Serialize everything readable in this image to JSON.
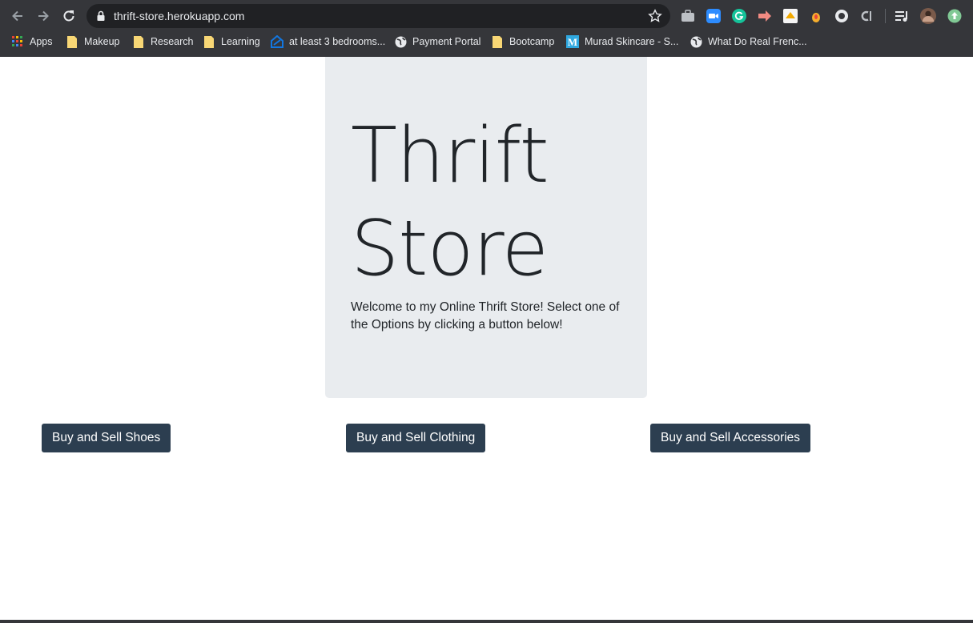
{
  "browser": {
    "url": "thrift-store.herokuapp.com",
    "bookmarks": [
      {
        "label": "Apps",
        "icon": "apps-grid-icon"
      },
      {
        "label": "Makeup",
        "icon": "folder-icon"
      },
      {
        "label": "Research",
        "icon": "folder-icon"
      },
      {
        "label": "Learning",
        "icon": "folder-icon"
      },
      {
        "label": "at least 3 bedrooms...",
        "icon": "zillow-icon"
      },
      {
        "label": "Payment Portal",
        "icon": "globe-icon"
      },
      {
        "label": "Bootcamp",
        "icon": "folder-icon"
      },
      {
        "label": "Murad Skincare - S...",
        "icon": "murad-icon"
      },
      {
        "label": "What Do Real Frenc...",
        "icon": "globe-icon"
      }
    ],
    "colors": {
      "chrome": "#35363a",
      "omnibox": "#202124",
      "folder": "#f8d775"
    }
  },
  "hero": {
    "title": "Thrift Store",
    "lead": "Welcome to my Online Thrift Store! Select one of the Options by clicking a button below!",
    "background": "#e9ecef"
  },
  "buttons": [
    {
      "label": "Buy and Sell Shoes"
    },
    {
      "label": "Buy and Sell Clothing"
    },
    {
      "label": "Buy and Sell Accessories"
    }
  ],
  "colors": {
    "button": "#2c3e50",
    "text": "#212529"
  }
}
